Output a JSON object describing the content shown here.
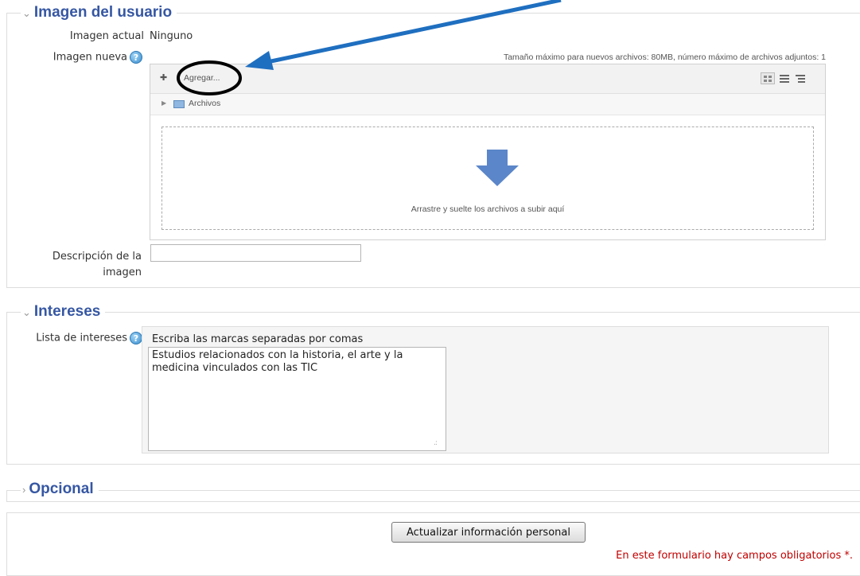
{
  "sections": {
    "image": {
      "legend": "Imagen del usuario",
      "current_label": "Imagen actual",
      "current_value": "Ninguno",
      "new_label": "Imagen nueva",
      "max_info": "Tamaño máximo para nuevos archivos: 80MB, número máximo de archivos adjuntos: 1",
      "add_label": "Agregar...",
      "folder_label": "Archivos",
      "drop_text": "Arrastre y suelte los archivos a subir aquí",
      "description_label_1": "Descripción de la",
      "description_label_2": "imagen",
      "description_value": ""
    },
    "interests": {
      "legend": "Intereses",
      "list_label": "Lista de intereses",
      "tags_hint": "Escriba las marcas separadas por comas",
      "tags_value": "Estudios relacionados con la historia, el arte y la medicina vinculados con las TIC"
    },
    "optional": {
      "legend": "Opcional"
    }
  },
  "footer": {
    "submit_label": "Actualizar información personal",
    "required_note": "En este formulario hay campos obligatorios",
    "required_mark": "*."
  },
  "colors": {
    "legend": "#3657a3",
    "annotation_arrow": "#1f6fc0",
    "required_text": "#c00000"
  }
}
